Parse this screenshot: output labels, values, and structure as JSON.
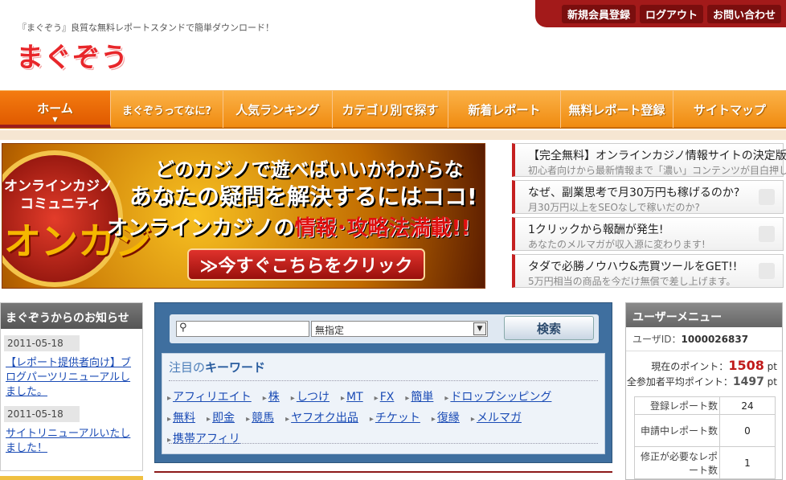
{
  "header": {
    "tagline": "『まぐぞう』良質な無料レポートスタンドで簡単ダウンロード！",
    "logo_text": "まぐぞう",
    "top_links": [
      "新規会員登録",
      "ログアウト",
      "お問い合わせ"
    ]
  },
  "nav": {
    "items": [
      "ホーム",
      "まぐぞうってなに?",
      "人気ランキング",
      "カテゴリ別で探す",
      "新着レポート",
      "無料レポート登録",
      "サイトマップ"
    ]
  },
  "banner": {
    "circle_line1": "オンラインカジノ",
    "circle_line2": "コミュニティ",
    "circle_line3": "オンカジ",
    "line1": "どのカジノで遊べばいいかわからない‥",
    "line2": "あなたの疑問を解決するにはココ!",
    "line3_a": "オンラインカジノの",
    "line3_b": "情報･攻略法満載!!",
    "cta": "≫今すぐこちらをクリック"
  },
  "ads": [
    {
      "title": "【完全無料】オンラインカジノ情報サイトの決定版",
      "sub": "初心者向けから最新情報まで「濃い」コンテンツが目白押し!"
    },
    {
      "title": "なぜ、副業思考で月30万円も稼げるのか?",
      "sub": "月30万円以上をSEOなしで稼いだのか?"
    },
    {
      "title": "1クリックから報酬が発生!",
      "sub": "あなたのメルマガが収入源に変わります!"
    },
    {
      "title": "タダで必勝ノウハウ&売買ツールをGET!!",
      "sub": "5万円相当の商品を今だけ無償で差し上げます。"
    }
  ],
  "news": {
    "header": "まぐぞうからのお知らせ",
    "items": [
      {
        "date": "2011-05-18",
        "text": "【レポート提供者向け】ブログパーツリニューアルしました。"
      },
      {
        "date": "2011-05-18",
        "text": "サイトリニューアルいたしました！"
      }
    ]
  },
  "search": {
    "input_value": "",
    "select_value": "無指定",
    "button": "検索",
    "kw_title_a": "注目の",
    "kw_title_b": "キーワード",
    "keywords": [
      "アフィリエイト",
      "株",
      "しつけ",
      "MT",
      "FX",
      "簡単",
      "ドロップシッピング",
      "無料",
      "即金",
      "競馬",
      "ヤフオク出品",
      "チケット",
      "復縁",
      "メルマガ",
      "携帯アフィリ"
    ]
  },
  "user": {
    "header": "ユーザーメニュー",
    "id_label": "ユーザID：",
    "id_value": "1000026837",
    "points_label": "現在のポイント：",
    "points_value": "1508",
    "points_unit": "pt",
    "avg_label": "全参加者平均ポイント：",
    "avg_value": "1497",
    "avg_unit": "pt",
    "rows": [
      {
        "label": "登録レポート数",
        "value": "24"
      },
      {
        "label": "申請中レポート数",
        "value": "0"
      },
      {
        "label": "修正が必要なレポート数",
        "value": "1"
      }
    ]
  }
}
